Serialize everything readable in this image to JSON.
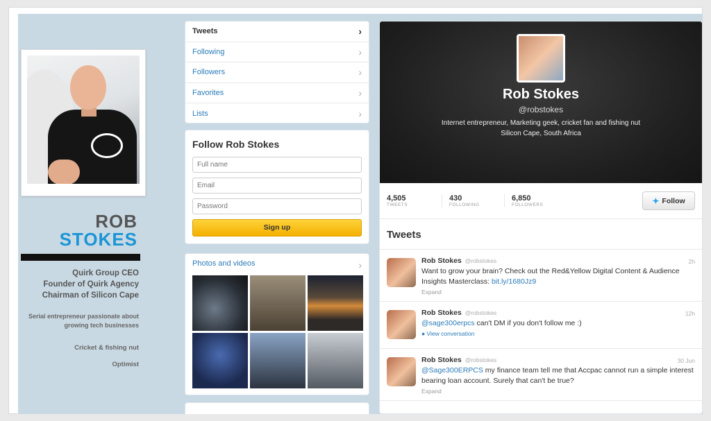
{
  "brand": {
    "first_name": "ROB",
    "last_name": "STOKES",
    "roles": [
      "Quirk Group CEO",
      "Founder of Quirk Agency",
      "Chairman of Silicon Cape"
    ],
    "description": "Serial entrepreneur passionate about growing tech businesses",
    "hobby": "Cricket & fishing nut",
    "trait": "Optimist"
  },
  "nav": {
    "items": [
      {
        "label": "Tweets"
      },
      {
        "label": "Following"
      },
      {
        "label": "Followers"
      },
      {
        "label": "Favorites"
      },
      {
        "label": "Lists"
      }
    ],
    "chevron": "›"
  },
  "follow": {
    "title": "Follow Rob Stokes",
    "fullname_placeholder": "Full name",
    "email_placeholder": "Email",
    "password_placeholder": "Password",
    "signup_label": "Sign up"
  },
  "media": {
    "title": "Photos and videos"
  },
  "profile": {
    "name": "Rob Stokes",
    "handle": "@robstokes",
    "bio": "Internet entrepreneur, Marketing geek, cricket fan and fishing nut",
    "location": "Silicon Cape, South Africa",
    "stats": [
      {
        "value": "4,505",
        "label": "TWEETS"
      },
      {
        "value": "430",
        "label": "FOLLOWING"
      },
      {
        "value": "6,850",
        "label": "FOLLOWERS"
      }
    ],
    "follow_label": "Follow"
  },
  "tweets": {
    "title": "Tweets",
    "items": [
      {
        "author": "Rob Stokes",
        "handle": "@robstokes",
        "time": "2h",
        "text": "Want to grow your brain? Check out the Red&Yellow Digital Content & Audience Insights Masterclass: ",
        "link": "bit.ly/1680Jz9",
        "action": "Expand"
      },
      {
        "author": "Rob Stokes",
        "handle": "@robstokes",
        "time": "12h",
        "mention": "@sage300erpcs",
        "text": " can't DM if you don't follow me :)",
        "action": "View conversation"
      },
      {
        "author": "Rob Stokes",
        "handle": "@robstokes",
        "time": "30 Jun",
        "mention": "@Sage300ERPCS",
        "text": " my finance team tell me that Accpac cannot run a simple interest bearing loan account. Surely that can't be true?",
        "action": "Expand"
      }
    ]
  },
  "icons": {
    "bird": "twitter-bird-icon",
    "conversation": "conversation-bullet-icon"
  },
  "colors": {
    "accent_blue": "#1b95d6",
    "link_blue": "#2b7bb9",
    "signup_yellow": "#fdd33a",
    "background": "#c9d9e3"
  }
}
